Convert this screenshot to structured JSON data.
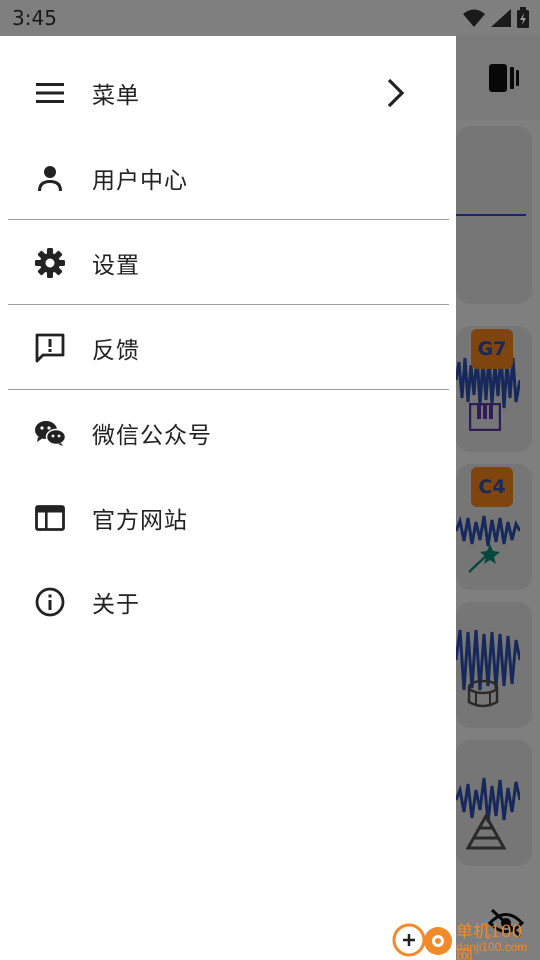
{
  "status_bar": {
    "time": "3:45"
  },
  "drawer": {
    "items": [
      {
        "label": "菜单",
        "icon": "menu-icon"
      },
      {
        "label": "用户中心",
        "icon": "person-icon"
      },
      {
        "label": "设置",
        "icon": "gear-icon"
      },
      {
        "label": "反馈",
        "icon": "feedback-icon"
      },
      {
        "label": "微信公众号",
        "icon": "wechat-icon"
      },
      {
        "label": "官方网站",
        "icon": "website-icon"
      },
      {
        "label": "关于",
        "icon": "info-icon"
      }
    ]
  },
  "background_app": {
    "chips": [
      "G7",
      "C4"
    ]
  },
  "watermark": {
    "text": "单机100网",
    "url": "danji100.com"
  },
  "colors": {
    "accent": "#ff8a1f",
    "wave": "#2f53b4",
    "drawer": "#ffffff"
  }
}
